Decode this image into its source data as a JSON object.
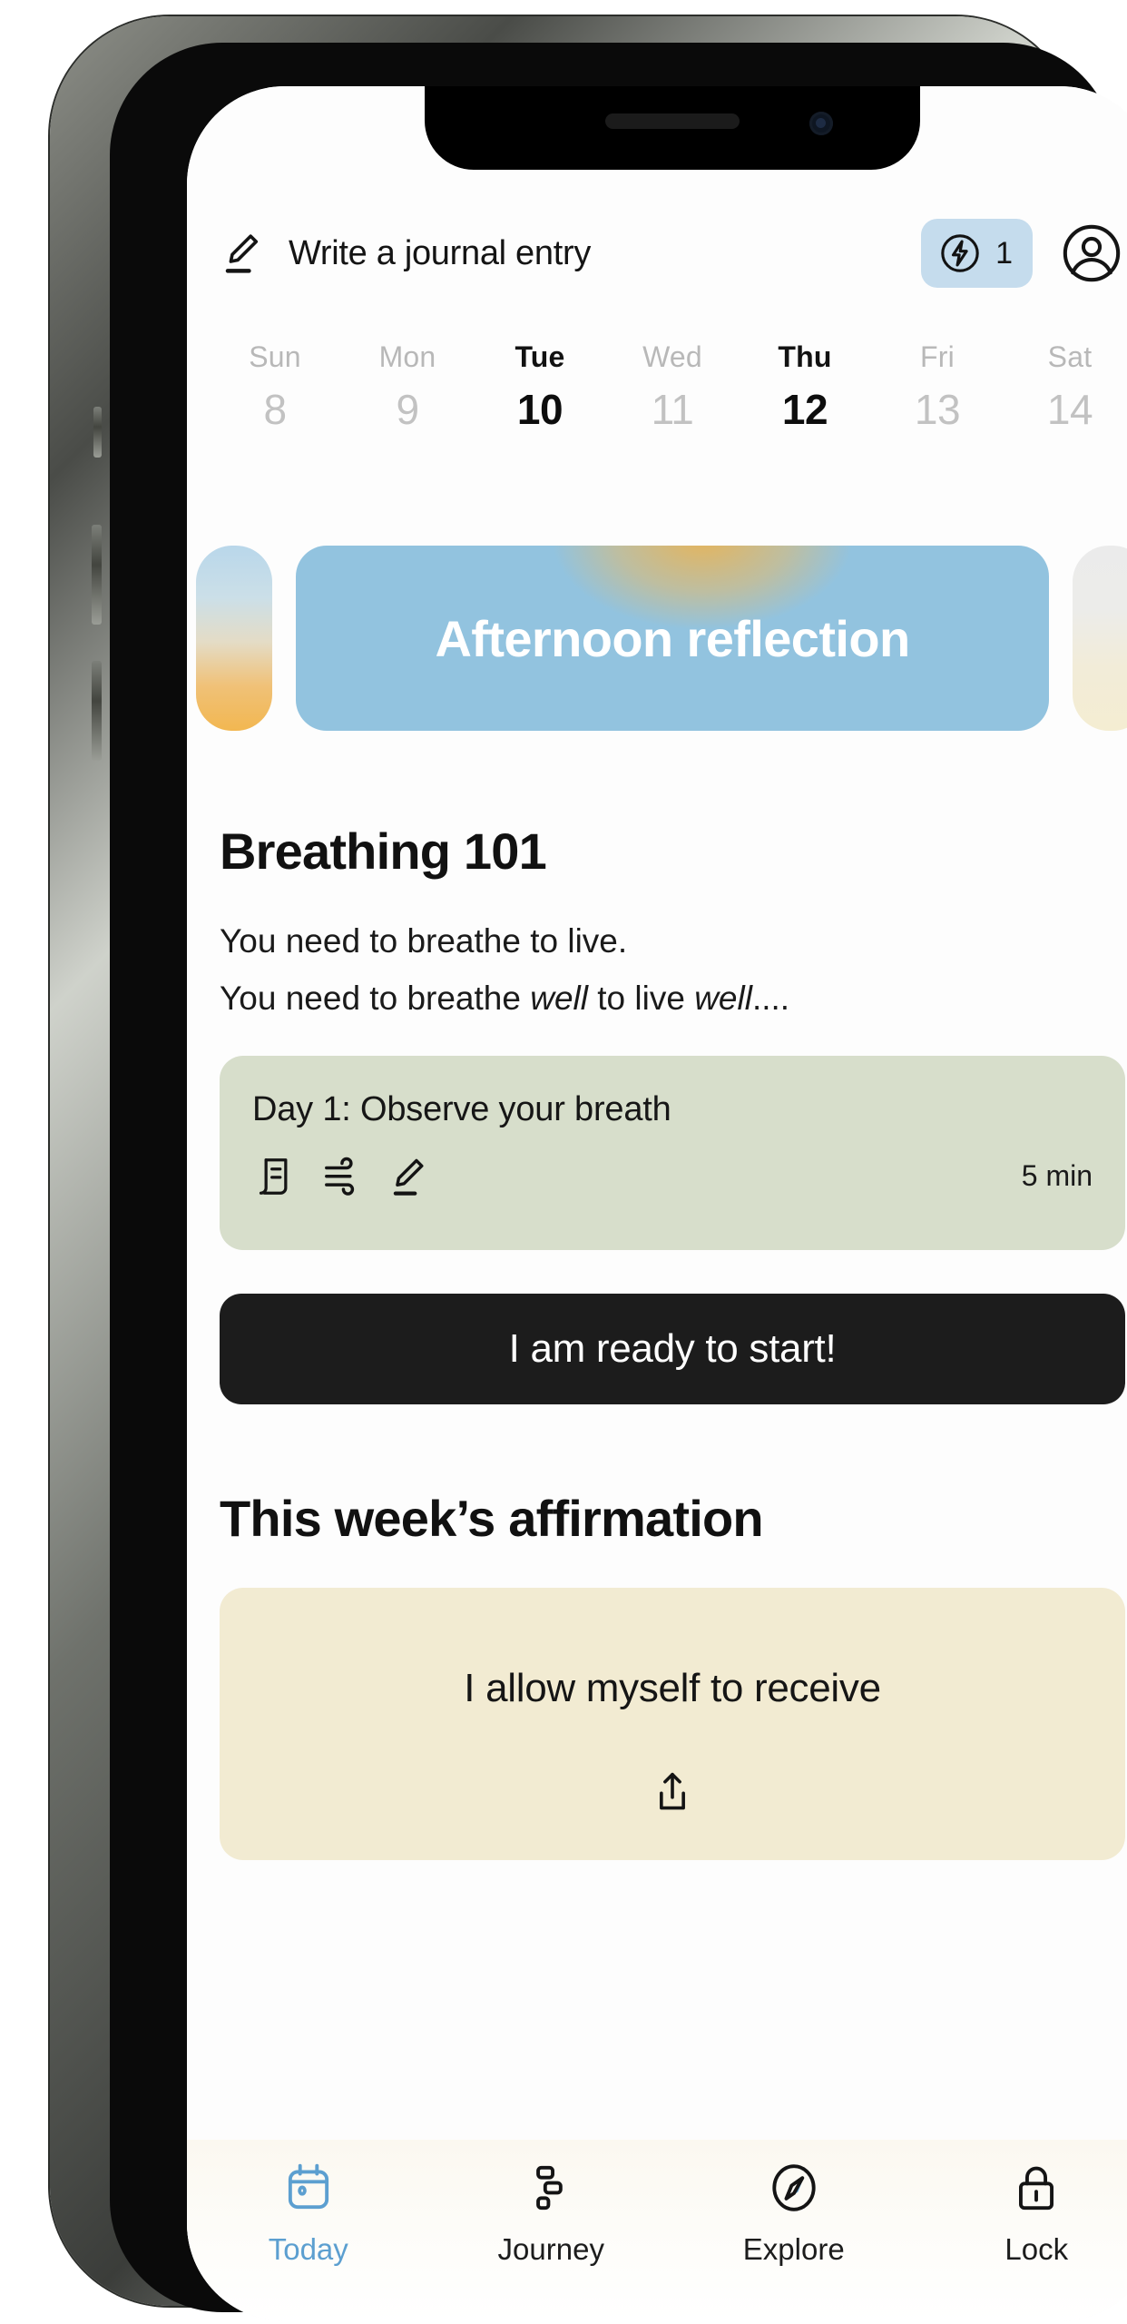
{
  "header": {
    "write_entry_label": "Write a journal entry",
    "write_entry_icon": "pencil-icon",
    "streak_icon": "lightning-bolt-icon",
    "streak_count": "1",
    "streak_bg_color": "#c5dced",
    "account_icon": "account-circle-icon"
  },
  "week": {
    "days": [
      {
        "dow": "Sun",
        "num": "8",
        "active": false
      },
      {
        "dow": "Mon",
        "num": "9",
        "active": false
      },
      {
        "dow": "Tue",
        "num": "10",
        "active": true
      },
      {
        "dow": "Wed",
        "num": "11",
        "active": false
      },
      {
        "dow": "Thu",
        "num": "12",
        "active": true
      },
      {
        "dow": "Fri",
        "num": "13",
        "active": false
      },
      {
        "dow": "Sat",
        "num": "14",
        "active": false
      }
    ]
  },
  "carousel": {
    "hero_title": "Afternoon reflection",
    "hero_bg_color": "#92c3df",
    "peek_left_colors": "#b9d7ea to #f2b751",
    "peek_right_colors": "#ebebeb to #f4edd2"
  },
  "breathing": {
    "title": "Breathing 101",
    "desc_line1": "You need to breathe to live.",
    "desc_line2_a": "You need to breathe ",
    "desc_line2_em1": "well",
    "desc_line2_b": " to live ",
    "desc_line2_em2": "well",
    "desc_line2_c": "....",
    "day_card": {
      "title": "Day 1: Observe your breath",
      "duration": "5 min",
      "bg_color": "#d7decb",
      "icons": [
        "article-icon",
        "breath-wind-icon",
        "pencil-icon"
      ]
    },
    "cta_label": "I am ready to start!",
    "cta_bg_color": "#1c1c1c"
  },
  "affirmation": {
    "title": "This week’s affirmation",
    "text": "I allow myself to receive",
    "bg_color": "#f2ebd2",
    "share_icon": "share-upload-icon"
  },
  "tabbar": {
    "active_color": "#5c9fd0",
    "tabs": [
      {
        "label": "Today",
        "icon": "calendar-icon",
        "active": true
      },
      {
        "label": "Journey",
        "icon": "blocks-icon",
        "active": false
      },
      {
        "label": "Explore",
        "icon": "compass-icon",
        "active": false
      },
      {
        "label": "Lock",
        "icon": "padlock-icon",
        "active": false
      }
    ]
  }
}
